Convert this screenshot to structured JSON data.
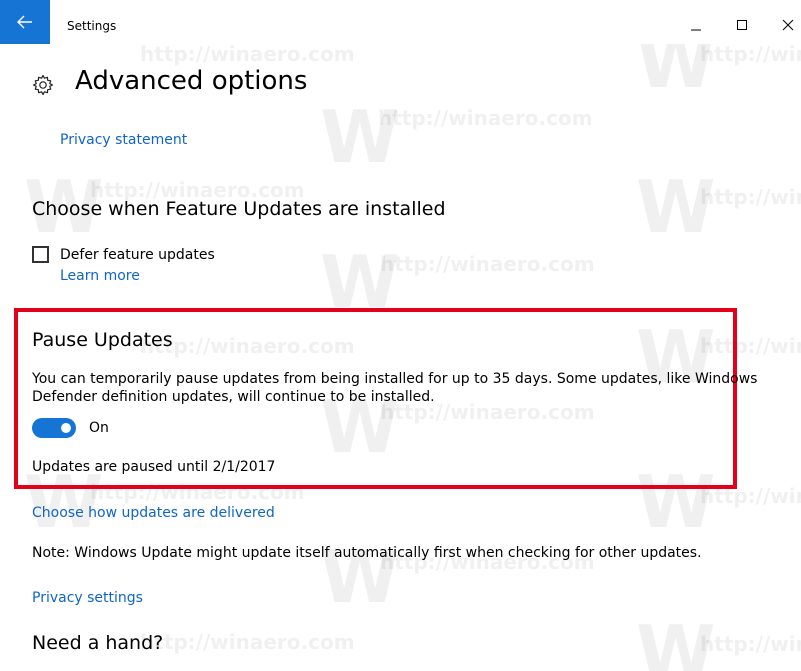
{
  "window": {
    "title": "Settings",
    "accent_color": "#1574d4",
    "link_color": "#1065c7",
    "highlight_color": "#e3001b"
  },
  "icons": {
    "back": "back-arrow-icon",
    "minimize": "minimize-icon",
    "maximize": "maximize-icon",
    "close": "close-icon",
    "page": "gear-icon"
  },
  "page": {
    "title": "Advanced options",
    "privacy_statement_link": "Privacy statement"
  },
  "feature_updates": {
    "heading": "Choose when Feature Updates are installed",
    "defer_label": "Defer feature updates",
    "defer_checked": false,
    "learn_more_link": "Learn more"
  },
  "pause_updates": {
    "heading": "Pause Updates",
    "description_line1": "You can temporarily pause updates from being installed for up to 35 days. Some updates, like Windows",
    "description_line2": "Defender definition updates, will continue to be installed.",
    "toggle_state": "On",
    "status": "Updates are paused until 2/1/2017"
  },
  "delivery": {
    "link": "Choose how updates are delivered",
    "note": "Note: Windows Update might update itself automatically first when checking for other updates."
  },
  "privacy": {
    "link": "Privacy settings"
  },
  "help": {
    "heading": "Need a hand?"
  },
  "watermark": {
    "letter": "W",
    "url": "http://winaero.com"
  }
}
